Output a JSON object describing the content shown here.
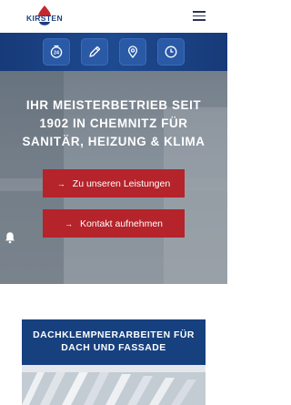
{
  "header": {
    "logo_text": "KIRSTEN",
    "menu_icon": "hamburger-menu-icon"
  },
  "iconbar": {
    "items": [
      {
        "icon": "emergency-24h-icon"
      },
      {
        "icon": "pencil-icon"
      },
      {
        "icon": "location-pin-icon"
      },
      {
        "icon": "clock-icon"
      }
    ]
  },
  "hero": {
    "title": "IHR MEISTERBETRIEB SEIT 1902 IN CHEMNITZ FÜR SANITÄR, HEIZUNG & KLIMA",
    "buttons": [
      {
        "label": "Zu unseren Leistungen",
        "icon": "arrow-right-icon"
      },
      {
        "label": "Kontakt aufnehmen",
        "icon": "arrow-right-icon"
      }
    ],
    "side_icon": "bell-icon"
  },
  "card": {
    "title": "DACHKLEMPNERARBEITEN FÜR DACH UND FASSADE"
  },
  "colors": {
    "brand_blue": "#1c3f7d",
    "accent_red": "#b5232b"
  }
}
